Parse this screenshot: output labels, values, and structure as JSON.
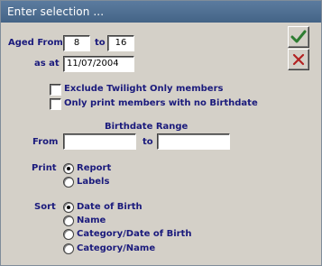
{
  "window": {
    "title": "Enter selection ..."
  },
  "aged": {
    "from_label": "Aged From",
    "from_value": "8",
    "to_label": "to",
    "to_value": "16"
  },
  "as_at": {
    "label": "as at",
    "value": "11/07/2004"
  },
  "options": {
    "exclude_twilight": {
      "label": "Exclude Twilight Only members",
      "checked": false
    },
    "only_no_birthdate": {
      "label": "Only print members with no Birthdate",
      "checked": false
    }
  },
  "birthdate_range": {
    "heading": "Birthdate Range",
    "from_label": "From",
    "from_value": "",
    "to_label": "to",
    "to_value": ""
  },
  "print": {
    "label": "Print",
    "choices": [
      {
        "label": "Report",
        "selected": true
      },
      {
        "label": "Labels",
        "selected": false
      }
    ]
  },
  "sort": {
    "label": "Sort",
    "choices": [
      {
        "label": "Date of Birth",
        "selected": true
      },
      {
        "label": "Name",
        "selected": false
      },
      {
        "label": "Category/Date of Birth",
        "selected": false
      },
      {
        "label": "Category/Name",
        "selected": false
      }
    ]
  },
  "buttons": {
    "ok_icon": "checkmark-icon",
    "cancel_icon": "x-icon"
  },
  "colors": {
    "title_bg": "#4f6f93",
    "label_text": "#1a1a7c",
    "dialog_bg": "#d4d0c8"
  }
}
